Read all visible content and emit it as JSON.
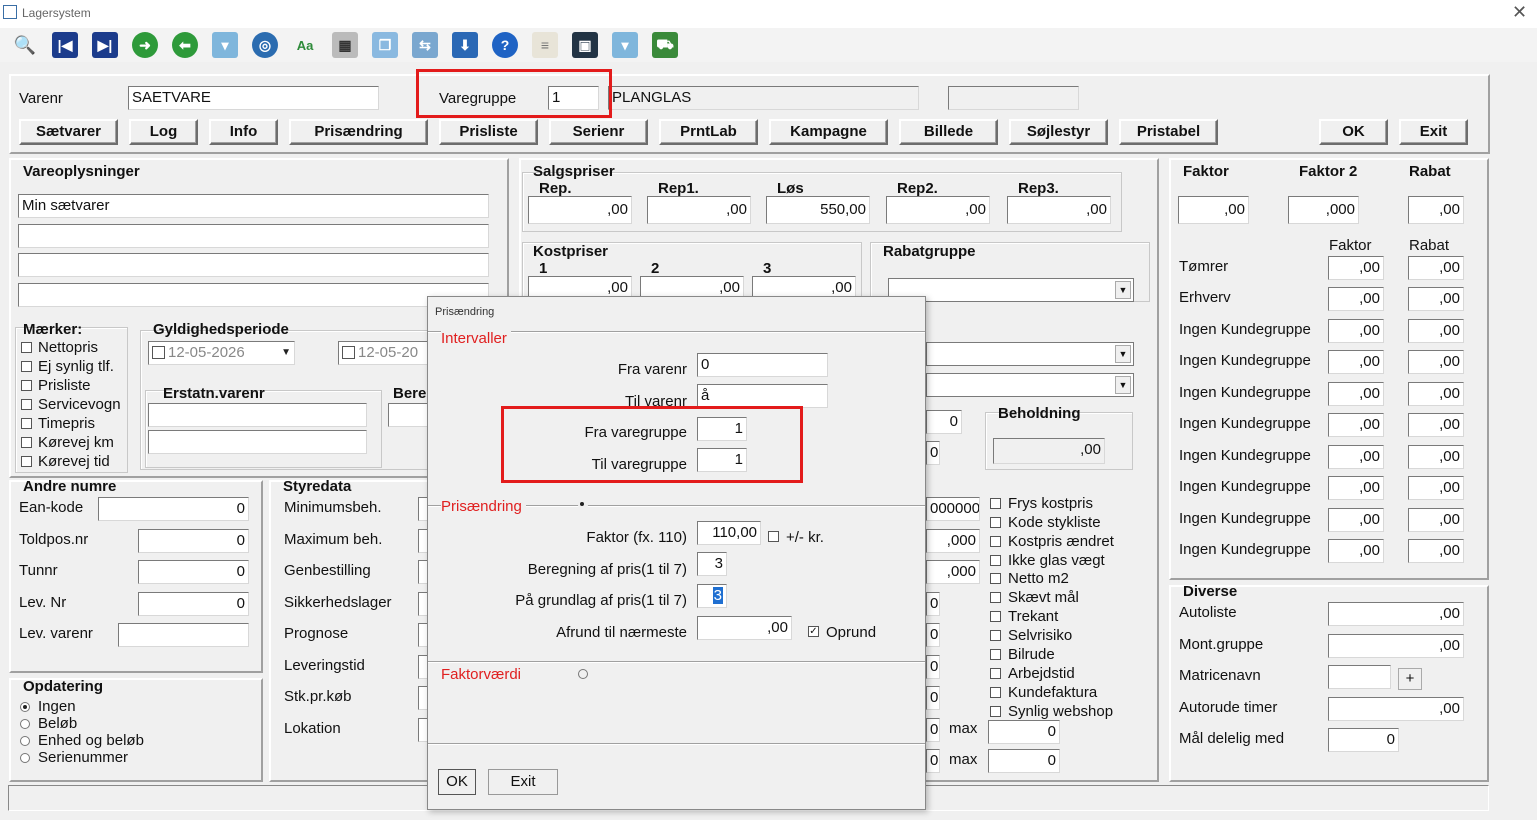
{
  "window": {
    "title": "Lagersystem",
    "close": "✕"
  },
  "toolbar": {
    "icons": [
      "search-icon",
      "first-record-icon",
      "last-record-icon",
      "forward-icon",
      "back-icon",
      "delete-icon",
      "target-icon",
      "font-icon",
      "calculator-icon",
      "copy-icon",
      "transfer-icon",
      "download-icon",
      "help-icon",
      "document-icon",
      "screen-icon",
      "trash-icon",
      "truck-icon"
    ]
  },
  "header": {
    "varenr_label": "Varenr",
    "varenr_value": "SAETVARE",
    "varegruppe_label": "Varegruppe",
    "varegruppe_value": "1",
    "varegruppe_name": "PLANGLAS",
    "extra_value": ""
  },
  "buttons": {
    "saetvarer": "Sætvarer",
    "log": "Log",
    "info": "Info",
    "prisaendring": "Prisændring",
    "prisliste": "Prisliste",
    "serienr": "Serienr",
    "prntlab": "PrntLab",
    "kampagne": "Kampagne",
    "billede": "Billede",
    "soejlestyr": "Søjlestyr",
    "pristabel": "Pristabel",
    "ok": "OK",
    "exit": "Exit"
  },
  "vareoplysninger": {
    "title": "Vareoplysninger",
    "lines": [
      "Min sætvarer",
      "",
      "",
      ""
    ]
  },
  "maerker": {
    "title": "Mærker:",
    "items": [
      "Nettopris",
      "Ej synlig tlf.",
      "Prisliste",
      "Servicevogn",
      "Timepris",
      "Kørevej km",
      "Kørevej tid"
    ]
  },
  "gyldighed": {
    "title": "Gyldighedsperiode",
    "from": "12-05-2026",
    "to": "12-05-20"
  },
  "erstatn": {
    "title": "Erstatn.varenr",
    "bere_title": "Bere"
  },
  "andre_numre": {
    "title": "Andre numre",
    "rows": [
      {
        "label": "Ean-kode",
        "value": "0"
      },
      {
        "label": "Toldpos.nr",
        "value": "0"
      },
      {
        "label": "Tunnr",
        "value": "0"
      },
      {
        "label": "Lev. Nr",
        "value": "0"
      },
      {
        "label": "Lev. varenr",
        "value": ""
      }
    ]
  },
  "opdatering": {
    "title": "Opdatering",
    "options": [
      "Ingen",
      "Beløb",
      "Enhed og beløb",
      "Serienummer"
    ],
    "selected": 0
  },
  "styredata": {
    "title": "Styredata",
    "labels": [
      "Minimumsbeh.",
      "Maximum beh.",
      "Genbestilling",
      "Sikkerhedslager",
      "Prognose",
      "Leveringstid",
      "Stk.pr.køb",
      "Lokation"
    ]
  },
  "salgspriser": {
    "title": "Salgspriser",
    "cols": [
      {
        "label": "Rep.",
        "value": ",00"
      },
      {
        "label": "Rep1.",
        "value": ",00"
      },
      {
        "label": "Løs",
        "value": "550,00"
      },
      {
        "label": "Rep2.",
        "value": ",00"
      },
      {
        "label": "Rep3.",
        "value": ",00"
      }
    ]
  },
  "kostpriser": {
    "title": "Kostpriser",
    "cols": [
      {
        "label": "1",
        "value": ",00"
      },
      {
        "label": "2",
        "value": ",00"
      },
      {
        "label": "3",
        "value": ",00"
      }
    ]
  },
  "rabatgruppe": {
    "title": "Rabatgruppe"
  },
  "mid": {
    "small1": "0",
    "small2": "0",
    "beholdning_title": "Beholdning",
    "beholdning_value": ",00",
    "vals": [
      "000000",
      ",000",
      ",000"
    ],
    "zeros": [
      "0",
      "0",
      "0",
      "0",
      "0",
      "0",
      "0",
      "0"
    ],
    "max_label": "max",
    "max1": "0",
    "max2": "0"
  },
  "flags": [
    "Frys kostpris",
    "Kode stykliste",
    "Kostpris ændret",
    "Ikke glas vægt",
    "Netto m2",
    "Skævt mål",
    "Trekant",
    "Selvrisiko",
    "Bilrude",
    "Arbejdstid",
    "Kundefaktura",
    "Synlig webshop"
  ],
  "faktor_panel": {
    "faktor_label": "Faktor",
    "faktor2_label": "Faktor 2",
    "rabat_label": "Rabat",
    "faktor_value": ",00",
    "faktor2_value": ",000",
    "rabat_value": ",00",
    "sub_faktor": "Faktor",
    "sub_rabat": "Rabat",
    "rows": [
      {
        "label": "Tømrer",
        "f": ",00",
        "r": ",00"
      },
      {
        "label": "Erhverv",
        "f": ",00",
        "r": ",00"
      },
      {
        "label": "Ingen Kundegruppe",
        "f": ",00",
        "r": ",00"
      },
      {
        "label": "Ingen Kundegruppe",
        "f": ",00",
        "r": ",00"
      },
      {
        "label": "Ingen Kundegruppe",
        "f": ",00",
        "r": ",00"
      },
      {
        "label": "Ingen Kundegruppe",
        "f": ",00",
        "r": ",00"
      },
      {
        "label": "Ingen Kundegruppe",
        "f": ",00",
        "r": ",00"
      },
      {
        "label": "Ingen Kundegruppe",
        "f": ",00",
        "r": ",00"
      },
      {
        "label": "Ingen Kundegruppe",
        "f": ",00",
        "r": ",00"
      },
      {
        "label": "Ingen Kundegruppe",
        "f": ",00",
        "r": ",00"
      }
    ]
  },
  "diverse": {
    "title": "Diverse",
    "autoliste_label": "Autoliste",
    "autoliste": ",00",
    "montgruppe_label": "Mont.gruppe",
    "montgruppe": ",00",
    "matricenavn_label": "Matricenavn",
    "matricenavn": "",
    "plus": "+",
    "autorude_label": "Autorude timer",
    "autorude": ",00",
    "maal_label": "Mål delelig med",
    "maal": "0"
  },
  "dialog": {
    "title": "Prisændring",
    "intervaller": "Intervaller",
    "fra_varenr_label": "Fra varenr",
    "fra_varenr": "0",
    "til_varenr_label": "Til varenr",
    "til_varenr": "å",
    "fra_varegruppe_label": "Fra varegruppe",
    "fra_varegruppe": "1",
    "til_varegruppe_label": "Til varegruppe",
    "til_varegruppe": "1",
    "prisaendring": "Prisændring",
    "faktor_label": "Faktor (fx. 110)",
    "faktor": "110,00",
    "plusminus_label": "+/- kr.",
    "beregning_label": "Beregning af pris(1 til 7)",
    "beregning": "3",
    "grundlag_label": "På grundlag af pris(1 til 7)",
    "grundlag": "3",
    "afrund_label": "Afrund til nærmeste",
    "afrund": ",00",
    "oprund_label": "Oprund",
    "faktorvaerdi": "Faktorværdi",
    "ok": "OK",
    "exit": "Exit"
  }
}
